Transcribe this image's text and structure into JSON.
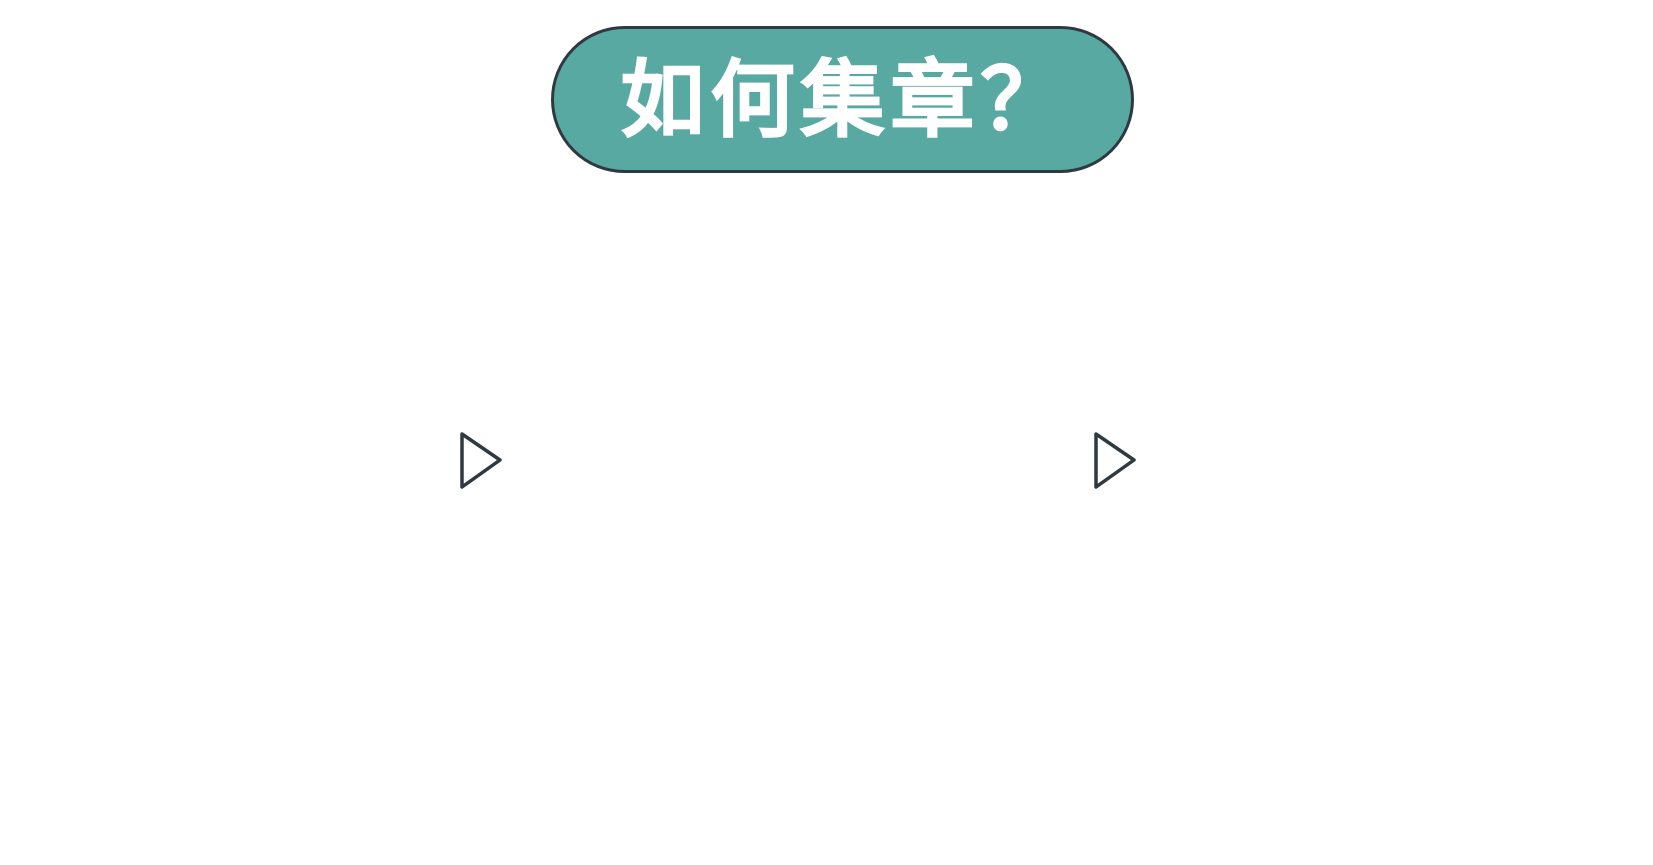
{
  "title": {
    "text": "如何集章？"
  },
  "controls": {
    "left_icon": "play-triangle-outline-icon",
    "right_icon": "play-triangle-outline-icon"
  },
  "colors": {
    "pill_fill": "#58a9a1",
    "pill_border": "#2f3a40",
    "title_text": "#ffffff",
    "icon_stroke": "#2f3a40",
    "background": "#ffffff"
  }
}
